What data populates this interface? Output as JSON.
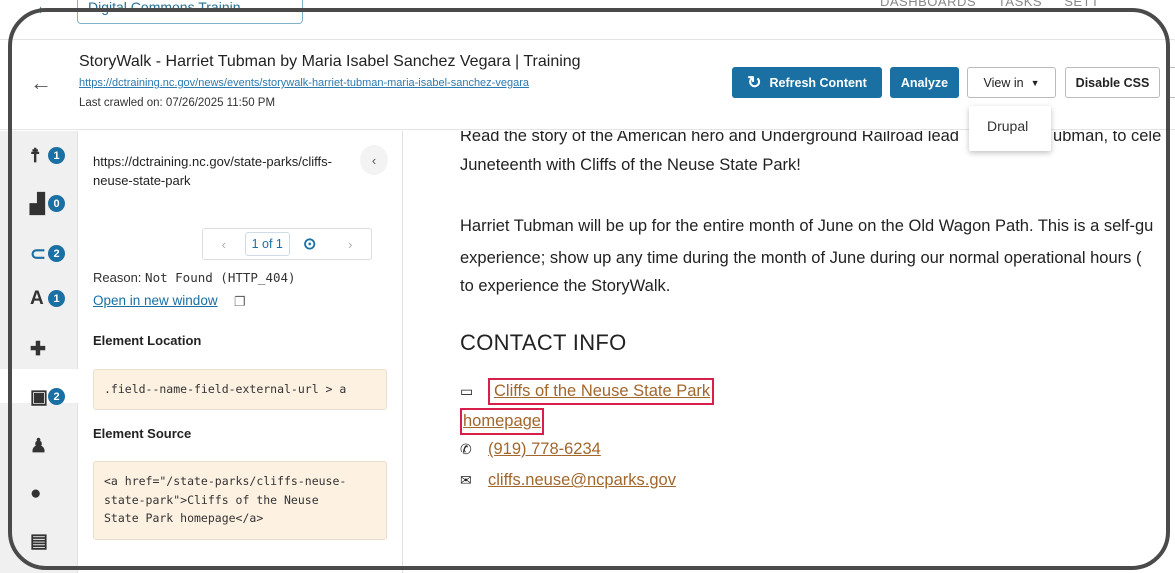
{
  "app": {
    "site_selector": "Digital Commons Trainin...",
    "top_nav": [
      "DASHBOARDS",
      "TASKS",
      "SETT"
    ]
  },
  "header": {
    "title": "StoryWalk - Harriet Tubman by Maria Isabel Sanchez Vegara | Training",
    "url": "https://dctraining.nc.gov/news/events/storywalk-harriet-tubman-maria-isabel-sanchez-vegara",
    "last_crawled": "Last crawled on: 07/26/2025 11:50 PM",
    "refresh_label": "Refresh Content",
    "analyze_label": "Analyze",
    "view_in_label": "View in",
    "disable_css_label": "Disable CSS",
    "view_in_options": [
      "Drupal"
    ]
  },
  "rail": {
    "items": [
      {
        "icon": "accessibility-icon",
        "glyph": "☨",
        "badge": "1"
      },
      {
        "icon": "thumbs-up-icon",
        "glyph": "▟",
        "badge": "0"
      },
      {
        "icon": "broken-link-icon",
        "glyph": "⊂",
        "badge": "2",
        "active": true
      },
      {
        "icon": "spelling-icon",
        "glyph": "A",
        "badge": "1"
      },
      {
        "icon": "puzzle-icon",
        "glyph": "✚",
        "badge": ""
      },
      {
        "icon": "content-icon",
        "glyph": "▣",
        "badge": "2"
      },
      {
        "icon": "user-icon",
        "glyph": "♟",
        "badge": ""
      },
      {
        "icon": "info-icon",
        "glyph": "●",
        "badge": ""
      },
      {
        "icon": "clipboard-icon",
        "glyph": "▤",
        "badge": ""
      }
    ]
  },
  "panel": {
    "target_url": "https://dctraining.nc.gov/state-parks/cliffs-neuse-state-park",
    "pager_count": "1 of 1",
    "reason_label": "Reason:",
    "reason_value": "Not Found (HTTP_404)",
    "open_new_window": "Open in new window",
    "element_location_label": "Element Location",
    "element_location": ".field--name-field-external-url > a",
    "element_source_label": "Element Source",
    "element_source": "<a href=\"/state-parks/cliffs-neuse-\nstate-park\">Cliffs of the Neuse\nState Park homepage</a>"
  },
  "content": {
    "line1": "Read the story of the American hero and Underground Railroad lead",
    "line1_end": "Tubman, to cele",
    "line2": "Juneteenth with Cliffs of the Neuse State Park!",
    "line3": "Harriet Tubman will be up for the entire month of June on the Old Wagon Path. This is a self-gu",
    "line4": "experience; show up any time during the month of June during our normal operational hours (",
    "line5": "to experience the StoryWalk.",
    "contact_heading": "CONTACT INFO",
    "link_part1": "Cliffs of the Neuse State Park",
    "link_part2": "homepage",
    "phone": "(919) 778-6234",
    "email": "cliffs.neuse@ncparks.gov"
  },
  "colors": {
    "primary": "#1a6fa3",
    "highlight": "#d81e4a",
    "link": "#a2672d",
    "code_bg": "#fdf1e2"
  }
}
